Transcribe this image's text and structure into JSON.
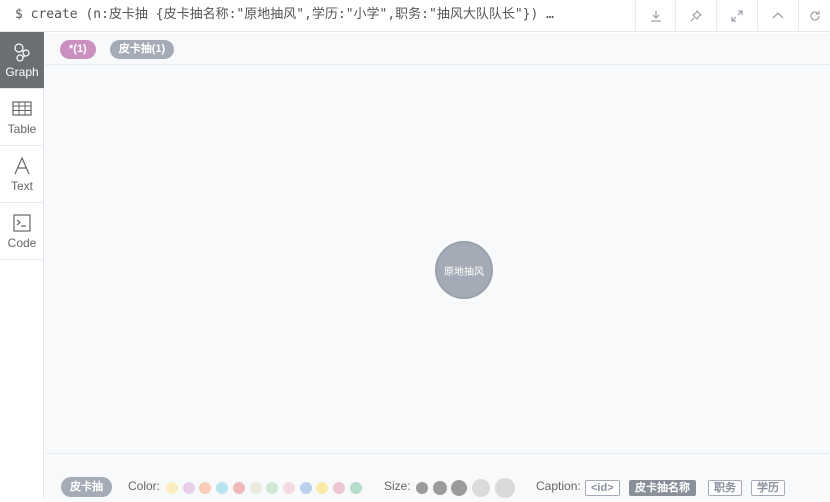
{
  "query": "$ create (n:皮卡抽 {皮卡抽名称:\"原地抽风\",学历:\"小学\",职务:\"抽风大队队长\"}) …",
  "sidebar": {
    "items": [
      {
        "label": "Graph",
        "icon": "graph-icon",
        "active": true
      },
      {
        "label": "Table",
        "icon": "table-icon",
        "active": false
      },
      {
        "label": "Text",
        "icon": "text-icon",
        "active": false
      },
      {
        "label": "Code",
        "icon": "code-icon",
        "active": false
      }
    ]
  },
  "legend": {
    "all_label": "*(1)",
    "node_label": "皮卡抽(1)"
  },
  "node": {
    "caption": "原地抽风",
    "color": "#a5abb6"
  },
  "bottom": {
    "label": "皮卡抽",
    "color_label": "Color:",
    "size_label": "Size:",
    "caption_label": "Caption:",
    "colors": [
      "#fcedc0",
      "#e6d0ec",
      "#f9ccb8",
      "#b8e4f2",
      "#f3b9b9",
      "#ece8e0",
      "#cde9cf",
      "#f5d9e4",
      "#bcd0ee",
      "#fdeaa8",
      "#f1c6d4",
      "#b6dccb"
    ],
    "captions": [
      "<id>",
      "皮卡抽名称",
      "职务",
      "学历"
    ],
    "selected_caption": "皮卡抽名称"
  }
}
